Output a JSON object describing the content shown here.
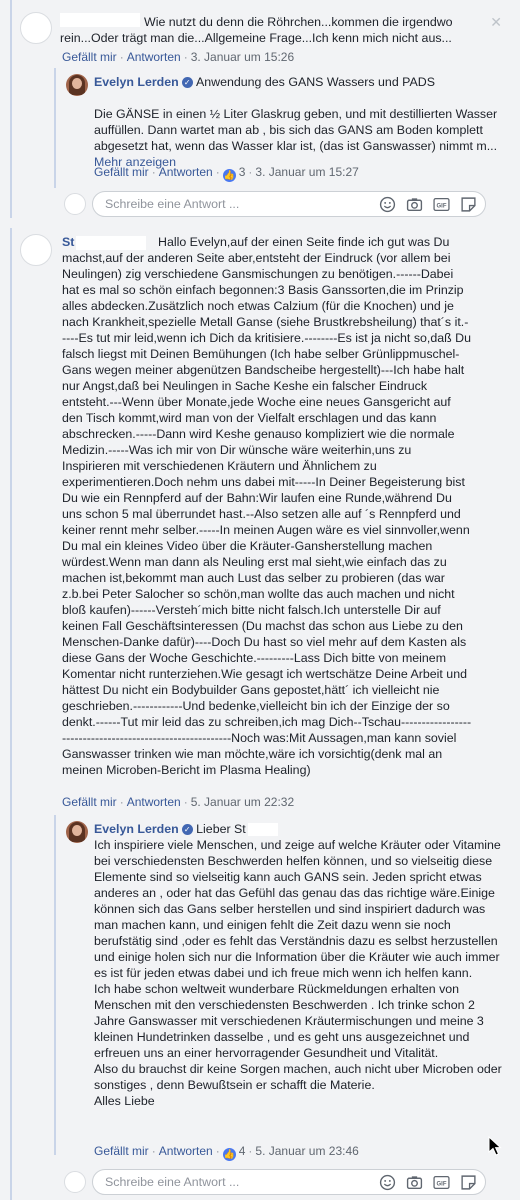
{
  "actions": {
    "like": "Gefällt mir",
    "reply": "Antworten",
    "show_more": "Mehr anzeigen"
  },
  "reply_placeholder": "Schreibe eine Antwort ...",
  "thread1": {
    "comment": {
      "text": "Wie nutzt du denn die Röhrchen...kommen die irgendwo rein...Oder trägt man die...Allgemeine Frage...Ich kenn mich nicht aus...",
      "time": "3. Januar um 15:26"
    },
    "reply": {
      "author": "Evelyn Lerden",
      "text": "Anwendung des GANS Wassers und PADS\n\nDie GÄNSE in einen ½ Liter Glaskrug geben, und mit destillierten Wasser auffüllen. Dann wartet man ab , bis sich das GANS am Boden komplett abgesetzt hat, wenn das Wasser klar ist, (das ist Ganswasser) nimmt m...",
      "likes": "3",
      "time": "3. Januar um 15:27"
    }
  },
  "thread2": {
    "comment": {
      "author_visible": "St",
      "text": "Hallo Evelyn,auf der einen Seite finde ich gut was Du machst,auf der anderen Seite aber,entsteht der Eindruck (vor allem bei Neulingen) zig verschiedene Gansmischungen zu benötigen.------Dabei hat es mal so schön einfach begonnen:3 Basis Ganssorten,die im Prinzip alles abdecken.Zusätzlich noch etwas Calzium (für die Knochen) und je nach Krankheit,spezielle Metall Ganse (siehe Brustkrebsheilung) that´s it.-----Es tut mir leid,wenn ich Dich da kritisiere.--------Es ist ja nicht so,daß Du falsch liegst mit Deinen Bemühungen (Ich habe selber Grünlippmuschel-Gans wegen meiner abgenützen Bandscheibe hergestellt)---Ich habe halt nur Angst,daß bei Neulingen in Sache Keshe ein falscher Eindruck entsteht.---Wenn über Monate,jede Woche eine neues Gansgericht auf den Tisch kommt,wird man von der Vielfalt erschlagen und das kann abschrecken.-----Dann wird Keshe genauso kompliziert wie die normale Medizin.-----Was ich mir von Dir wünsche wäre weiterhin,uns zu Inspirieren mit verschiedenen Kräutern und Ähnlichem zu experimentieren.Doch nehm uns dabei mit-----In Deiner Begeisterung bist Du wie ein Rennpferd auf der Bahn:Wir laufen eine Runde,während Du uns schon 5 mal überrundet hast.--Also setzen alle auf ´s Rennpferd und keiner rennt mehr selber.-----In meinen Augen wäre es viel sinnvoller,wenn Du mal ein kleines Video über die Kräuter-Gansherstellung machen würdest.Wenn man dann als Neuling erst mal sieht,wie einfach das zu machen ist,bekommt man auch Lust das selber zu probieren (das war z.b.bei Peter Salocher so schön,man wollte das auch machen und nicht bloß kaufen)------Versteh´mich bitte nicht falsch.Ich unterstelle Dir auf keinen Fall Geschäftsinteressen (Du machst das schon aus Liebe zu den Menschen-Danke dafür)----Doch Du hast so viel mehr auf dem Kasten als diese Gans der Woche Geschichte.---------Lass Dich bitte von meinem Komentar nicht runterziehen.Wie gesagt ich wertschätze Deine Arbeit und hättest Du nicht ein Bodybuilder Gans gepostet,hätt´ ich vielleicht nie geschrieben.------------Und bedenke,vielleicht bin ich der Einzige der so denkt.------Tut mir leid das zu schreiben,ich mag Dich--Tschau----------------------------------------------------------Noch was:Mit Aussagen,man kann soviel Ganswasser trinken wie man möchte,wäre ich vorsichtig(denk mal an meinen Microben-Bericht im Plasma Healing)",
      "time": "5. Januar um 22:32"
    },
    "reply": {
      "author": "Evelyn Lerden",
      "greeting": "Lieber St",
      "text": "Ich inspiriere viele Menschen, und zeige auf welche Kräuter oder Vitamine bei verschiedensten Beschwerden helfen können, und so vielseitig diese Elemente sind so vielseitig kann auch GANS sein. Jeden spricht etwas anderes an , oder hat das Gefühl das genau das das richtige wäre.Einige können sich das Gans selber herstellen und sind inspiriert dadurch was man machen kann, und einigen fehlt die Zeit dazu wenn sie noch berufstätig sind ,oder es fehlt das Verständnis dazu es selbst herzustellen und einige holen sich nur die Information über die Kräuter wie auch immer es ist für jeden etwas dabei und ich freue mich wenn ich helfen kann.\nIch habe schon weltweit wunderbare Rückmeldungen erhalten von Menschen mit den verschiedensten Beschwerden . Ich trinke schon 2 Jahre Ganswasser mit verschiedenen Kräutermischungen und meine 3 kleinen Hundetrinken dasselbe , und es geht uns ausgezeichnet und erfreuen uns an einer hervorragender Gesundheit und Vitalität.\nAlso du brauchst dir keine Sorgen machen, auch nicht uber Microben oder sonstiges , denn Bewußtsein er schafft die Materie.\nAlles Liebe",
      "likes": "4",
      "time": "5. Januar um 23:46"
    }
  },
  "icons": [
    "close-icon",
    "verified-badge-icon",
    "like-thumb-icon",
    "emoji-icon",
    "camera-icon",
    "gif-icon",
    "sticker-icon",
    "mouse-cursor-icon"
  ],
  "colors": {
    "link": "#385898",
    "meta": "#606770",
    "thread_line": "#c9d4e8",
    "like_badge": "#4a78f0"
  }
}
